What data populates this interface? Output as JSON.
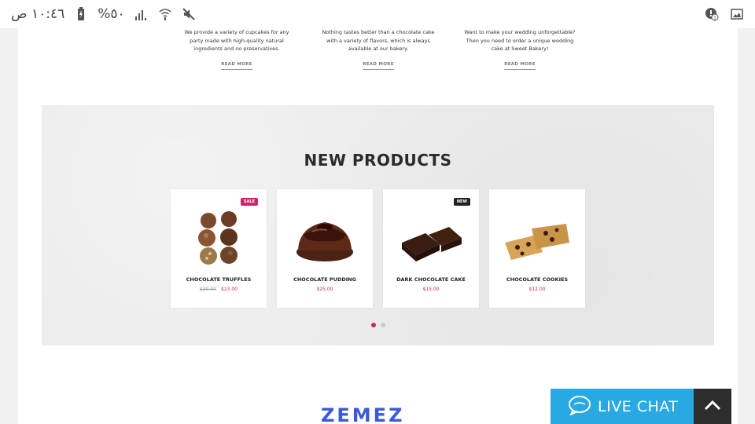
{
  "status_bar": {
    "time": "١٠:٤٦ ص",
    "battery": "%٥٠",
    "icons": [
      "battery-icon",
      "signal-icon",
      "wifi-icon",
      "mute-icon",
      "notification-alert-icon",
      "image-icon"
    ]
  },
  "features": [
    {
      "text": "We provide a variety of cupcakes for any party made with high-quality natural ingredients and no preservatives.",
      "link": "READ MORE"
    },
    {
      "text": "Nothing tastes better than a chocolate cake with a variety of flavors, which is always available at our bakery.",
      "link": "READ MORE"
    },
    {
      "text": "Want to make your wedding unforgettable? Then you need to order a unique wedding cake at Sweet Bakery!",
      "link": "READ MORE"
    }
  ],
  "products": {
    "title": "NEW PRODUCTS",
    "items": [
      {
        "name": "CHOCOLATE TRUFFLES",
        "old_price": "$30.00",
        "price": "$23.00",
        "badge": "SALE",
        "art": "truffles"
      },
      {
        "name": "CHOCOLATE PUDDING",
        "old_price": "",
        "price": "$25.00",
        "badge": "",
        "art": "pudding"
      },
      {
        "name": "DARK CHOCOLATE CAKE",
        "old_price": "",
        "price": "$15.00",
        "badge": "NEW",
        "art": "cake"
      },
      {
        "name": "CHOCOLATE COOKIES",
        "old_price": "",
        "price": "$12.00",
        "badge": "",
        "art": "cookies"
      }
    ],
    "slider_dots": 2,
    "active_dot": 0
  },
  "logo": "ZEMEZ",
  "live_chat": {
    "label": "LIVE CHAT"
  },
  "colors": {
    "accent": "#d0246a",
    "chat": "#29a9e4",
    "scroll_top": "#2d2d2d",
    "logo": "#3b5bd6"
  }
}
